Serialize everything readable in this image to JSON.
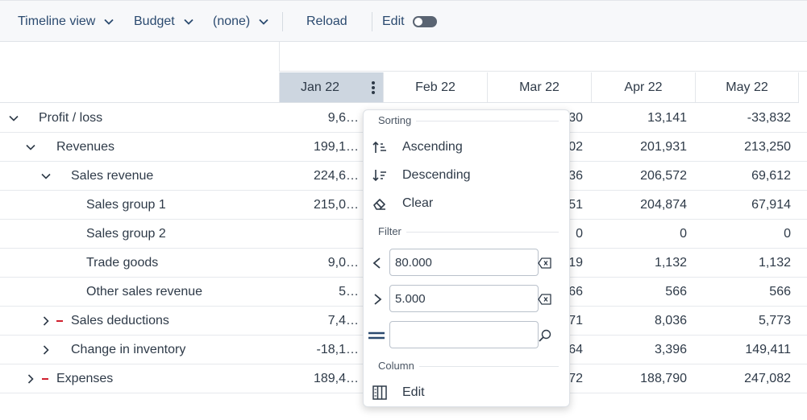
{
  "toolbar": {
    "view_label": "Timeline view",
    "budget_label": "Budget",
    "none_label": "(none)",
    "reload_label": "Reload",
    "edit_label": "Edit"
  },
  "columns": [
    "Jan 22",
    "Feb 22",
    "Mar 22",
    "Apr 22",
    "May 22"
  ],
  "rows": [
    {
      "label": "Profit / loss",
      "values": [
        "9,6…",
        "",
        "30",
        "13,141",
        "-33,832"
      ]
    },
    {
      "label": "Revenues",
      "values": [
        "199,1…",
        "",
        "02",
        "201,931",
        "213,250"
      ]
    },
    {
      "label": "Sales revenue",
      "values": [
        "224,6…",
        "",
        "36",
        "206,572",
        "69,612"
      ]
    },
    {
      "label": "Sales group 1",
      "values": [
        "215,0…",
        "",
        "51",
        "204,874",
        "67,914"
      ]
    },
    {
      "label": "Sales group 2",
      "values": [
        "",
        "",
        "0",
        "0",
        "0"
      ]
    },
    {
      "label": "Trade goods",
      "values": [
        "9,0…",
        "",
        "19",
        "1,132",
        "1,132"
      ]
    },
    {
      "label": "Other sales revenue",
      "values": [
        "5…",
        "",
        "66",
        "566",
        "566"
      ]
    },
    {
      "label": "Sales deductions",
      "values": [
        "7,4…",
        "",
        "71",
        "8,036",
        "5,773"
      ]
    },
    {
      "label": "Change in inventory",
      "values": [
        "-18,1…",
        "",
        "64",
        "3,396",
        "149,411"
      ]
    },
    {
      "label": "Expenses",
      "values": [
        "189,4…",
        "",
        "72",
        "188,790",
        "247,082"
      ]
    }
  ],
  "popup": {
    "sorting_title": "Sorting",
    "ascending_label": "Ascending",
    "descending_label": "Descending",
    "clear_label": "Clear",
    "filter_title": "Filter",
    "less_than_value": "80.000",
    "greater_than_value": "5.000",
    "equals_value": "",
    "column_title": "Column",
    "edit_label": "Edit"
  },
  "icons": {
    "expand": "chevron-down-icon",
    "collapsed": "chevron-right-icon",
    "sort_asc": "sort-ascending-icon",
    "sort_desc": "sort-descending-icon",
    "clear": "eraser-icon",
    "less_than": "less-than-icon",
    "greater_than": "greater-than-icon",
    "equals": "equals-icon",
    "clear_field": "backspace-icon",
    "search": "search-icon",
    "columns": "columns-icon"
  },
  "colors": {
    "accent": "#2b4a6f",
    "active_header": "#cdd6e0",
    "minus_marker": "#d0202e"
  }
}
